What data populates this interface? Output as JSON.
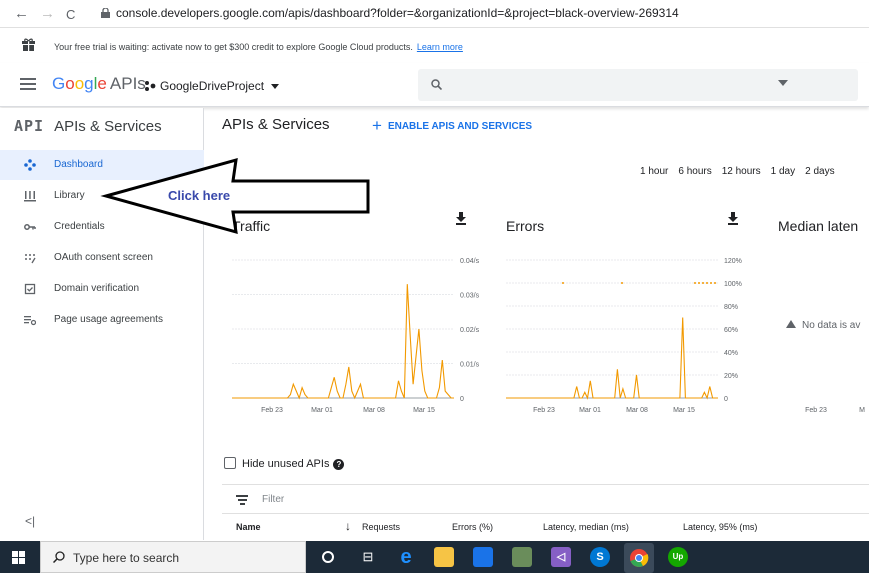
{
  "browser": {
    "back_icon": "←",
    "forward_icon": "→",
    "reload_icon": "C",
    "url": "console.developers.google.com/apis/dashboard?folder=&organizationId=&project=black-overview-269314"
  },
  "trial_banner": {
    "text": "Your free trial is waiting: activate now to get $300 credit to explore Google Cloud products.",
    "link": "Learn more"
  },
  "topbar": {
    "logo_google": [
      "G",
      "o",
      "o",
      "g",
      "l",
      "e"
    ],
    "logo_apis": "APIs",
    "project": "GoogleDriveProject",
    "search_icon": "🔍"
  },
  "sidebar": {
    "badge": "API",
    "title": "APIs & Services",
    "items": [
      {
        "label": "Dashboard",
        "icon": "dashboard-icon"
      },
      {
        "label": "Library",
        "icon": "library-icon"
      },
      {
        "label": "Credentials",
        "icon": "key-icon"
      },
      {
        "label": "OAuth consent screen",
        "icon": "consent-icon"
      },
      {
        "label": "Domain verification",
        "icon": "domain-icon"
      },
      {
        "label": "Page usage agreements",
        "icon": "settings-list-icon"
      }
    ],
    "collapse": "<|"
  },
  "main": {
    "title": "APIs & Services",
    "enable_button": "ENABLE APIS AND SERVICES",
    "time_ranges": [
      "1 hour",
      "6 hours",
      "12 hours",
      "1 day",
      "2 days"
    ],
    "annotation": "Click here",
    "no_data": "No data is av",
    "hide_unused": "Hide unused APIs",
    "filter_placeholder": "Filter",
    "table_headers": [
      "Name",
      "Requests",
      "Errors (%)",
      "Latency, median (ms)",
      "Latency, 95% (ms)"
    ],
    "sort_icon": "↓"
  },
  "chart_data": [
    {
      "type": "line",
      "title": "Traffic",
      "x_ticks": [
        "Feb 23",
        "Mar 01",
        "Mar 08",
        "Mar 15"
      ],
      "y_ticks": [
        "0",
        "0.01/s",
        "0.02/s",
        "0.03/s",
        "0.04/s"
      ],
      "ylim": [
        0,
        0.04
      ],
      "color": "#f29900",
      "series": [
        {
          "values": [
            0,
            0,
            0,
            0,
            0,
            0,
            0,
            0,
            0,
            0,
            0,
            0,
            0,
            0,
            0,
            0,
            0,
            0,
            0,
            0,
            0.001,
            0.004,
            0.002,
            0,
            0.003,
            0.001,
            0,
            0,
            0,
            0,
            0,
            0,
            0,
            0,
            0.003,
            0.006,
            0.002,
            0,
            0,
            0.004,
            0.009,
            0.002,
            0,
            0.002,
            0.004,
            0,
            0,
            0,
            0,
            0,
            0,
            0,
            0,
            0,
            0,
            0,
            0,
            0.005,
            0.002,
            0,
            0.033,
            0.018,
            0.004,
            0.012,
            0.02,
            0.008,
            0.002,
            0,
            0,
            0,
            0,
            0.003,
            0.011,
            0.002,
            0.001,
            0,
            0
          ]
        }
      ]
    },
    {
      "type": "line",
      "title": "Errors",
      "x_ticks": [
        "Feb 23",
        "Mar 01",
        "Mar 08",
        "Mar 15"
      ],
      "y_ticks": [
        "0",
        "20%",
        "40%",
        "60%",
        "80%",
        "100%",
        "120%"
      ],
      "ylim": [
        0,
        120
      ],
      "color": "#f29900",
      "series": [
        {
          "values": [
            0,
            0,
            0,
            0,
            0,
            0,
            0,
            0,
            0,
            0,
            0,
            0,
            0,
            0,
            0,
            0,
            0,
            0,
            0,
            0,
            0,
            0,
            0,
            0,
            0,
            0,
            10,
            0,
            0,
            5,
            0,
            15,
            0,
            0,
            0,
            0,
            0,
            0,
            0,
            0,
            0,
            25,
            0,
            8,
            0,
            0,
            0,
            0,
            20,
            0,
            0,
            0,
            0,
            0,
            0,
            0,
            0,
            0,
            0,
            0,
            0,
            0,
            0,
            0,
            0,
            70,
            0,
            0,
            0,
            0,
            0,
            0,
            0,
            5,
            0,
            10,
            0,
            0,
            0
          ]
        }
      ]
    },
    {
      "type": "line",
      "title": "Median laten",
      "x_ticks": [
        "Feb 23",
        "M"
      ]
    }
  ],
  "taskbar": {
    "search_placeholder": "Type here to search",
    "search_icon": "⌕"
  }
}
